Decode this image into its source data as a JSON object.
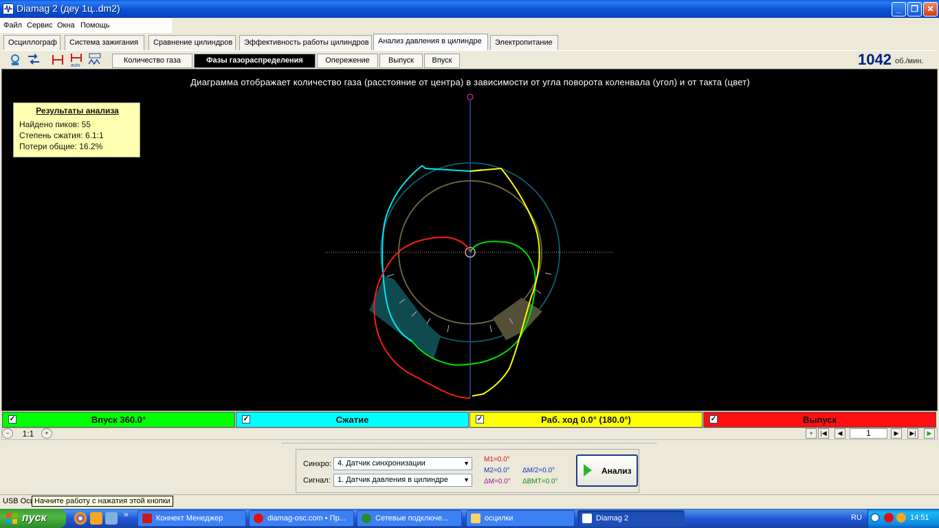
{
  "window": {
    "title": "Diamag 2 (деу 1ц..dm2)"
  },
  "menu": [
    "Файл",
    "Сервис",
    "Окна",
    "Помощь"
  ],
  "top_tabs": [
    "Осциллограф",
    "Система зажигания",
    "Сравнение цилиндров",
    "Эффективность работы цилиндров",
    "Анализ давления в цилиндре",
    "Электропитание"
  ],
  "top_tabs_active": "Анализ давления в цилиндре",
  "toolbar_icons": [
    "engine-icon",
    "sync-icon",
    "tdc-marker-icon",
    "auto-scale-icon",
    "waveform-icon"
  ],
  "sub_tabs": [
    "Количество газа",
    "Фазы газораспределения",
    "Опережение",
    "Выпуск",
    "Впуск"
  ],
  "sub_tabs_active": "Фазы газораспределения",
  "rpm": {
    "value": "1042",
    "unit": "об./мин."
  },
  "chart": {
    "caption": "Диаграмма отображает количество газа (расстояние от центра) в зависимости от угла поворота коленвала (угол) и от такта (цвет)",
    "colors": {
      "intake": "#00E000",
      "compression": "#00E8F0",
      "power": "#FFFF00",
      "exhaust": "#FF1A1A",
      "background": "#000000"
    }
  },
  "results": {
    "title": "Результаты анализа",
    "lines": [
      "Найдено пиков: 55",
      "Степень сжатия: 6.1:1",
      "Потери общие: 16.2%"
    ]
  },
  "strokes": [
    {
      "label": "Впуск 360.0°",
      "color": "#00FF00",
      "checked": true,
      "check": "✓"
    },
    {
      "label": "Сжатие",
      "color": "#00FFFF",
      "checked": true,
      "check": "✓"
    },
    {
      "label": "Раб. ход 0.0° (180.0°)",
      "color": "#FFFF00",
      "checked": true,
      "check": "✓"
    },
    {
      "label": "Выпуск",
      "color": "#FF1010",
      "checked": true,
      "check": "✓"
    }
  ],
  "zoom": {
    "value": "1:1",
    "minus": "−",
    "plus": "+"
  },
  "nav": {
    "page": "1",
    "add": "+",
    "first": "|◀",
    "prev": "◀",
    "next": "▶",
    "last": "▶|",
    "play": "▶"
  },
  "controls": {
    "sync_label": "Синхро:",
    "sync_value": "4.  Датчик синхронизации",
    "signal_label": "Сигнал:",
    "signal_value": "1.  Датчик давления в цилиндре",
    "dropdown_arrow": "▼",
    "m1": "M1=0.0°",
    "m2": "M2=0.0°",
    "dm": "ΔM=0.0°",
    "dm2": "ΔM/2=0.0°",
    "dbmt": "ΔВМТ=0.0°",
    "analyze": "Анализ"
  },
  "status": {
    "text": "USB Осц",
    "tooltip": "Начните работу с нажатия этой кнопки"
  },
  "taskbar": {
    "start": "пуск",
    "tasks": [
      "Коннект Менеджер",
      "diamag-osc.com • Пр...",
      "Сетевые подключе...",
      "осцилки",
      "Diamag 2"
    ],
    "active_task": "Diamag 2",
    "lang": "RU",
    "clock": "14:51",
    "overflow": "»"
  }
}
